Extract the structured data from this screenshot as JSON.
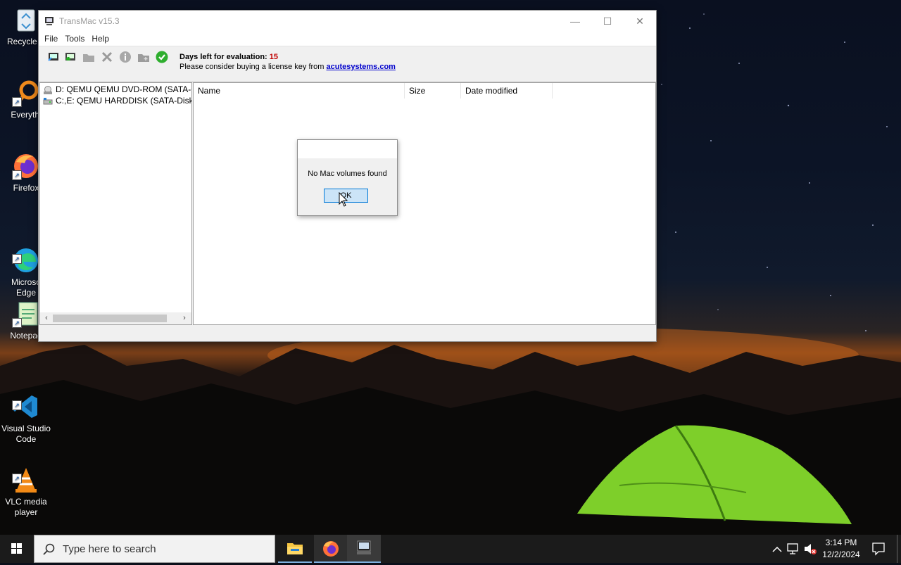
{
  "desktop": {
    "icons": [
      {
        "label": "Recycle B",
        "icon": "recycle-bin-icon"
      },
      {
        "label": "Everythi",
        "icon": "everything-search-icon"
      },
      {
        "label": "Firefox",
        "icon": "firefox-icon"
      },
      {
        "label": "Microso\nEdge",
        "icon": "edge-icon"
      },
      {
        "label": "Notepad",
        "icon": "notepad-icon"
      },
      {
        "label": "Visual Studio\nCode",
        "icon": "vscode-icon"
      },
      {
        "label": "VLC media\nplayer",
        "icon": "vlc-icon"
      }
    ]
  },
  "window": {
    "title": "TransMac v15.3",
    "controls": {
      "minimize": "—",
      "maximize": "☐",
      "close": "✕"
    },
    "menu": [
      "File",
      "Tools",
      "Help"
    ],
    "toolbar_icons": [
      "open-disk-icon",
      "save-disk-icon",
      "folder-icon",
      "delete-icon",
      "info-icon",
      "new-folder-icon",
      "help-icon"
    ],
    "eval": {
      "days_label": "Days left for evaluation:",
      "days_value": "15",
      "license_text": "Please consider buying a license key from",
      "license_link": "acutesystems.com"
    },
    "drives": [
      "D: QEMU QEMU DVD-ROM (SATA-CdR",
      "C:,E:  QEMU HARDDISK (SATA-Disk)"
    ],
    "columns": [
      "Name",
      "Size",
      "Date modified"
    ]
  },
  "dialog": {
    "message": "No Mac volumes found",
    "ok_label": "OK"
  },
  "taskbar": {
    "search_placeholder": "Type here to search",
    "time": "3:14 PM",
    "date": "12/2/2024"
  },
  "colors": {
    "accent": "#0078d7",
    "eval_days": "#c00000",
    "link": "#0000cc"
  }
}
